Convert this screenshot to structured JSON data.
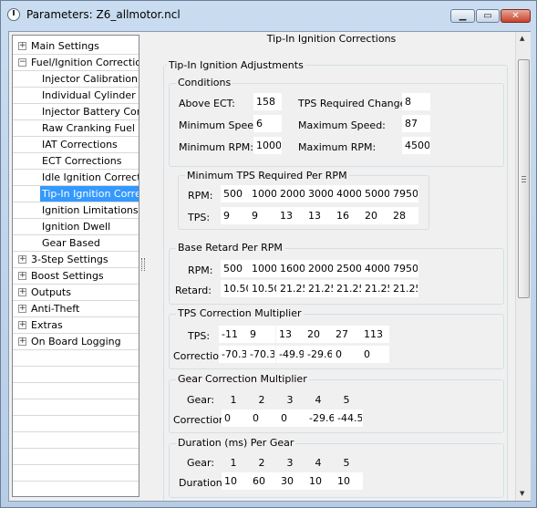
{
  "window": {
    "title": "Parameters: Z6_allmotor.ncl",
    "min_glyph": "▁",
    "max_glyph": "▭",
    "close_glyph": "✕"
  },
  "tree": [
    {
      "label": "Main Settings",
      "level": 0,
      "expander": "+"
    },
    {
      "label": "Fuel/Ignition Corrections",
      "level": 0,
      "expander": "−"
    },
    {
      "label": "Injector Calibration",
      "level": 1
    },
    {
      "label": "Individual Cylinder T...",
      "level": 1
    },
    {
      "label": "Injector Battery Corr...",
      "level": 1
    },
    {
      "label": "Raw Cranking Fuel",
      "level": 1
    },
    {
      "label": "IAT Corrections",
      "level": 1
    },
    {
      "label": "ECT Corrections",
      "level": 1
    },
    {
      "label": "Idle Ignition Correcti...",
      "level": 1
    },
    {
      "label": "Tip-In Ignition Corre...",
      "level": 1,
      "selected": true
    },
    {
      "label": "Ignition Limitations",
      "level": 1
    },
    {
      "label": "Ignition Dwell",
      "level": 1
    },
    {
      "label": "Gear Based",
      "level": 1
    },
    {
      "label": "3-Step Settings",
      "level": 0,
      "expander": "+"
    },
    {
      "label": "Boost Settings",
      "level": 0,
      "expander": "+"
    },
    {
      "label": "Outputs",
      "level": 0,
      "expander": "+"
    },
    {
      "label": "Anti-Theft",
      "level": 0,
      "expander": "+"
    },
    {
      "label": "Extras",
      "level": 0,
      "expander": "+"
    },
    {
      "label": "On Board Logging",
      "level": 0,
      "expander": "+"
    },
    {
      "label": "",
      "level": 0
    },
    {
      "label": "",
      "level": 0
    },
    {
      "label": "",
      "level": 0
    },
    {
      "label": "",
      "level": 0
    },
    {
      "label": "",
      "level": 0
    },
    {
      "label": "",
      "level": 0
    },
    {
      "label": "",
      "level": 0
    },
    {
      "label": "",
      "level": 0
    },
    {
      "label": "",
      "level": 0
    },
    {
      "label": "",
      "level": 0
    }
  ],
  "panel": {
    "title": "Tip-In Ignition Corrections",
    "outer_group": "Tip-In Ignition Adjustments",
    "conditions": {
      "label": "Conditions",
      "above_ect_label": "Above ECT:",
      "above_ect": "158",
      "tps_change_label": "TPS Required Change:",
      "tps_change": "8",
      "min_speed_label": "Minimum Speed:",
      "min_speed": "6",
      "max_speed_label": "Maximum Speed:",
      "max_speed": "87",
      "min_rpm_label": "Minimum RPM:",
      "min_rpm": "1000",
      "max_rpm_label": "Maximum RPM:",
      "max_rpm": "4500"
    },
    "min_tps": {
      "label": "Minimum TPS Required Per RPM",
      "row1_label": "RPM:",
      "rpm": [
        "500",
        "1000",
        "2000",
        "3000",
        "4000",
        "5000",
        "7950"
      ],
      "row2_label": "TPS:",
      "tps": [
        "9",
        "9",
        "13",
        "13",
        "16",
        "20",
        "28"
      ]
    },
    "base_retard": {
      "label": "Base Retard Per RPM",
      "row1_label": "RPM:",
      "rpm": [
        "500",
        "1000",
        "1600",
        "2000",
        "2500",
        "4000",
        "7950"
      ],
      "row2_label": "Retard:",
      "retard": [
        "10.50",
        "10.50",
        "21.25",
        "21.25",
        "21.25",
        "21.25",
        "21.25"
      ]
    },
    "tps_mult": {
      "label": "TPS Correction Multiplier",
      "row1_label": "TPS:",
      "tps": [
        "-11",
        "9",
        "13",
        "20",
        "27",
        "113"
      ],
      "row2_label": "Correction:",
      "correction": [
        "-70.3",
        "-70.3",
        "-49.9",
        "-29.6",
        "0",
        "0"
      ]
    },
    "gear_mult": {
      "label": "Gear Correction Multiplier",
      "row1_label": "Gear:",
      "gear": [
        "1",
        "2",
        "3",
        "4",
        "5"
      ],
      "row2_label": "Correction:",
      "correction": [
        "0",
        "0",
        "0",
        "-29.6",
        "-44.5"
      ]
    },
    "duration": {
      "label": "Duration (ms) Per Gear",
      "row1_label": "Gear:",
      "gear": [
        "1",
        "2",
        "3",
        "4",
        "5"
      ],
      "row2_label": "Duration:",
      "duration": [
        "10",
        "60",
        "30",
        "10",
        "10"
      ]
    },
    "scroll_up": "▲",
    "scroll_down": "▼"
  }
}
